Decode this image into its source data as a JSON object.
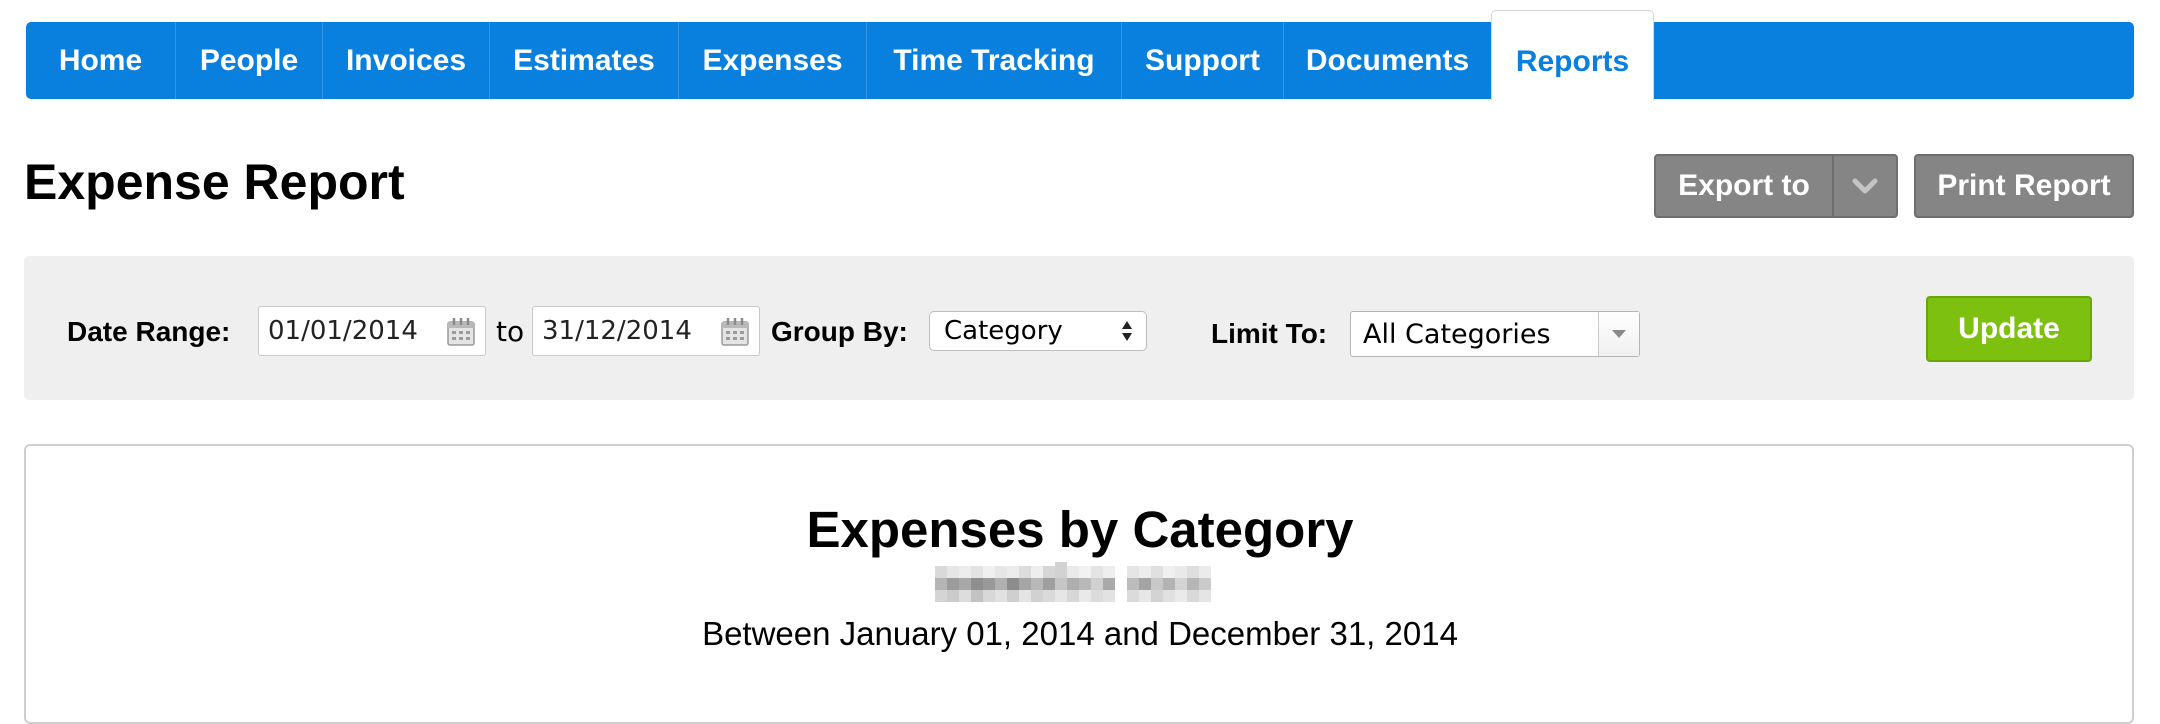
{
  "nav": {
    "tabs": [
      {
        "label": "Home",
        "active": false
      },
      {
        "label": "People",
        "active": false
      },
      {
        "label": "Invoices",
        "active": false
      },
      {
        "label": "Estimates",
        "active": false
      },
      {
        "label": "Expenses",
        "active": false
      },
      {
        "label": "Time Tracking",
        "active": false
      },
      {
        "label": "Support",
        "active": false
      },
      {
        "label": "Documents",
        "active": false
      },
      {
        "label": "Reports",
        "active": true
      }
    ]
  },
  "header": {
    "title": "Expense Report",
    "export_label": "Export to",
    "export_caret_icon": "chevron-down-icon",
    "print_label": "Print Report"
  },
  "filters": {
    "date_range_label": "Date Range:",
    "start_date": "01/01/2014",
    "to_label": "to",
    "end_date": "31/12/2014",
    "calendar_icon": "calendar-icon",
    "group_by_label": "Group By:",
    "group_by_value": "Category",
    "limit_to_label": "Limit To:",
    "limit_to_value": "All Categories",
    "update_label": "Update"
  },
  "report": {
    "title": "Expenses by Category",
    "range_text": "Between January 01, 2014 and December 31, 2014"
  },
  "colors": {
    "nav_blue": "#0a80de",
    "button_gray": "#858585",
    "update_green": "#7dc00f",
    "filter_bg": "#efefef"
  }
}
